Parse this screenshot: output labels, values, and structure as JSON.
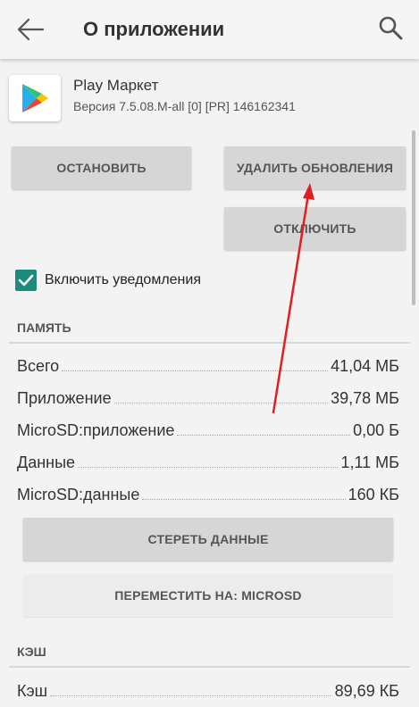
{
  "appbar": {
    "title": "О приложении",
    "back_icon": "arrow-left-icon",
    "search_icon": "search-icon"
  },
  "app": {
    "name": "Play Маркет",
    "version": "Версия 7.5.08.M-all [0] [PR] 146162341",
    "icon": "play-store-icon"
  },
  "buttons": {
    "stop": "ОСТАНОВИТЬ",
    "uninstall_updates": "УДАЛИТЬ ОБНОВЛЕНИЯ",
    "disable": "ОТКЛЮЧИТЬ",
    "clear_data": "СТЕРЕТЬ ДАННЫЕ",
    "move_to": "ПЕРЕМЕСТИТЬ НА: MICROSD"
  },
  "notifications": {
    "label": "Включить уведомления",
    "checked": true
  },
  "memory": {
    "header": "ПАМЯТЬ",
    "rows": [
      {
        "label": "Всего",
        "value": "41,04 МБ"
      },
      {
        "label": "Приложение",
        "value": "39,78 МБ"
      },
      {
        "label": "MicroSD:приложение",
        "value": "0,00 Б"
      },
      {
        "label": "Данные",
        "value": "1,11 МБ"
      },
      {
        "label": "MicroSD:данные",
        "value": "160 КБ"
      }
    ]
  },
  "cache": {
    "header": "КЭШ",
    "rows": [
      {
        "label": "Кэш",
        "value": "89,69 КБ"
      }
    ]
  },
  "colors": {
    "accent": "#1e8a7c",
    "annotation_arrow": "#e02020",
    "button_bg": "#d6d6d6",
    "button_disabled_bg": "#ececec"
  }
}
